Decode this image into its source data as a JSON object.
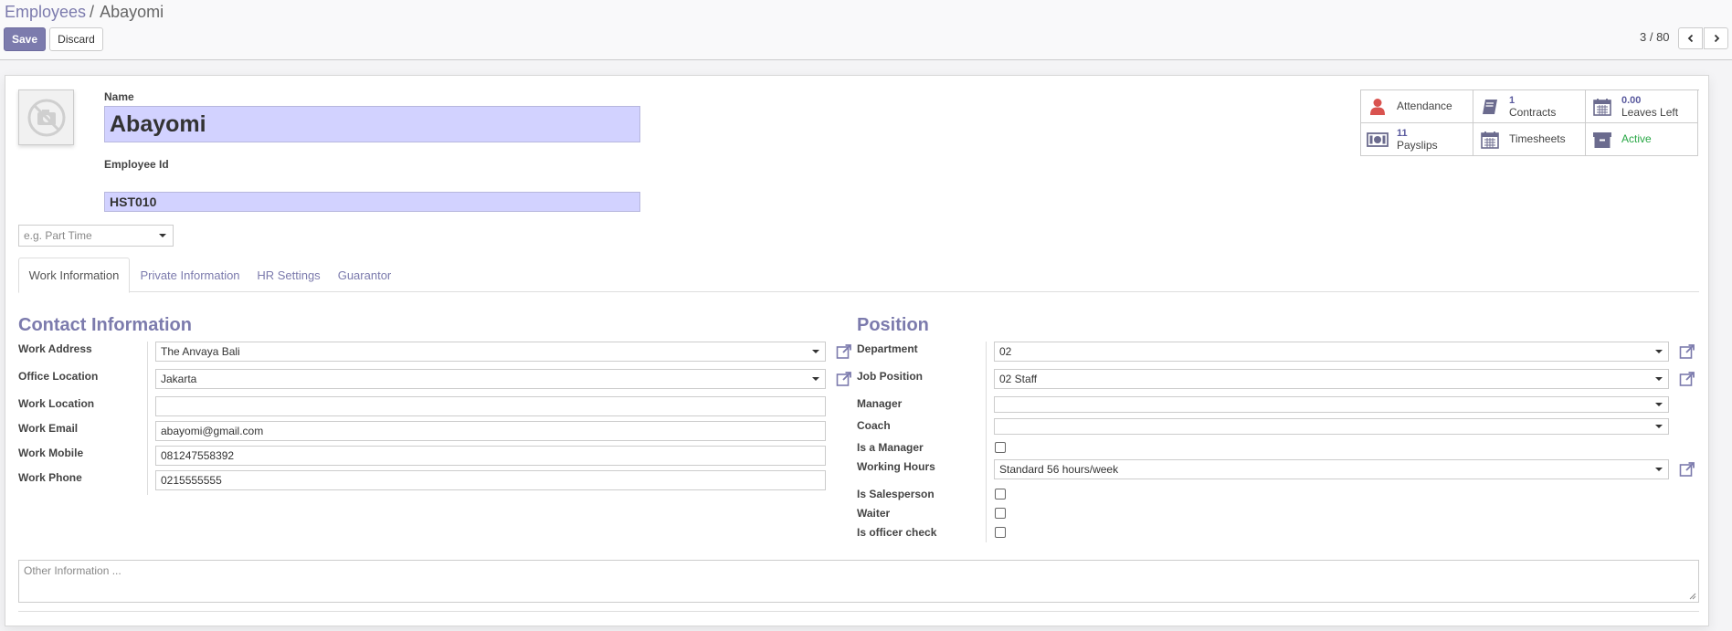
{
  "breadcrumb": {
    "parent": "Employees",
    "separator": "/",
    "current": "Abayomi"
  },
  "toolbar": {
    "save_label": "Save",
    "discard_label": "Discard"
  },
  "pager": {
    "value": "3 / 80"
  },
  "employee": {
    "name_label": "Name",
    "name": "Abayomi",
    "employee_id_label": "Employee Id",
    "employee_id": "HST010",
    "category_placeholder": "e.g. Part Time"
  },
  "smart_buttons": [
    {
      "icon": "user-icon",
      "number": "",
      "label": "Attendance"
    },
    {
      "icon": "book-icon",
      "number": "1",
      "label": "Contracts"
    },
    {
      "icon": "calendar-icon",
      "number": "0.00",
      "label": "Leaves Left"
    },
    {
      "icon": "money-icon",
      "number": "11",
      "label": "Payslips"
    },
    {
      "icon": "calendar-icon",
      "number": "",
      "label": "Timesheets"
    },
    {
      "icon": "archive-icon",
      "number": "",
      "label": "Active"
    }
  ],
  "tabs": [
    {
      "label": "Work Information",
      "active": true
    },
    {
      "label": "Private Information",
      "active": false
    },
    {
      "label": "HR Settings",
      "active": false
    },
    {
      "label": "Guarantor",
      "active": false
    }
  ],
  "contact": {
    "title": "Contact Information",
    "work_address": {
      "label": "Work Address",
      "value": "The Anvaya Bali"
    },
    "office_location": {
      "label": "Office Location",
      "value": "Jakarta"
    },
    "work_location": {
      "label": "Work Location",
      "value": ""
    },
    "work_email": {
      "label": "Work Email",
      "value": "abayomi@gmail.com"
    },
    "work_mobile": {
      "label": "Work Mobile",
      "value": "081247558392"
    },
    "work_phone": {
      "label": "Work Phone",
      "value": "0215555555"
    }
  },
  "position": {
    "title": "Position",
    "department": {
      "label": "Department",
      "value": "02"
    },
    "job_position": {
      "label": "Job Position",
      "value": "02 Staff"
    },
    "manager": {
      "label": "Manager",
      "value": ""
    },
    "coach": {
      "label": "Coach",
      "value": ""
    },
    "is_manager": {
      "label": "Is a Manager",
      "checked": false
    },
    "working_hours": {
      "label": "Working Hours",
      "value": "Standard 56 hours/week"
    },
    "is_salesperson": {
      "label": "Is Salesperson",
      "checked": false
    },
    "waiter": {
      "label": "Waiter",
      "checked": false
    },
    "is_officer_check": {
      "label": "Is officer check",
      "checked": false
    }
  },
  "notes": {
    "placeholder": "Other Information ..."
  },
  "colors": {
    "accent": "#7c7bad",
    "highlight": "#d2d2ff",
    "active_green": "#28a745",
    "attendance_red": "#d9534f"
  }
}
